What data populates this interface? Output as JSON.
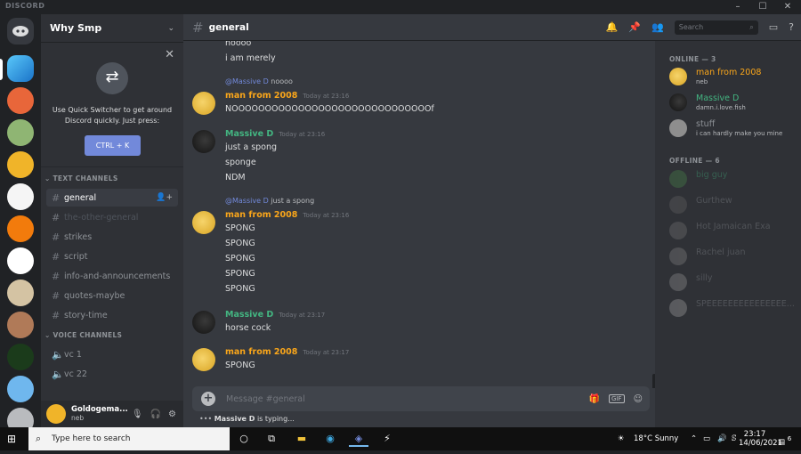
{
  "window": {
    "brand": "DISCORD",
    "controls": [
      "–",
      "☐",
      "✕"
    ]
  },
  "server": {
    "name": "Why Smp"
  },
  "quick_switcher": {
    "message": "Use Quick Switcher to get around Discord quickly. Just press:",
    "shortcut": "CTRL + K"
  },
  "categories": {
    "text": "TEXT CHANNELS",
    "voice": "VOICE CHANNELS"
  },
  "channels": [
    {
      "label": "general",
      "state": "active"
    },
    {
      "label": "the-other-general",
      "state": "muted"
    },
    {
      "label": "strikes",
      "state": "normal"
    },
    {
      "label": "script",
      "state": "normal"
    },
    {
      "label": "info-and-announcements",
      "state": "normal"
    },
    {
      "label": "quotes-maybe",
      "state": "normal"
    },
    {
      "label": "story-time",
      "state": "normal"
    }
  ],
  "voice_channels": [
    {
      "label": "vc 1"
    },
    {
      "label": "vc 22"
    }
  ],
  "user": {
    "name": "Goldogema...",
    "tag": "neb"
  },
  "header": {
    "channel": "general",
    "search_placeholder": "Search"
  },
  "messages": {
    "m1": "noooo",
    "m2": "i am merely",
    "r1_mention": "@Massive D",
    "r1_text": "noooo",
    "u1": "man from 2008",
    "t1": "Today at 23:16",
    "m3": "NOOOOOOOOOOOOOOOOOOOOOOOOOOOOOOf",
    "u2": "Massive D",
    "t2": "Today at 23:16",
    "m4": "just a spong",
    "m5": "sponge",
    "m6": "NDM",
    "r2_mention": "@Massive D",
    "r2_text": "just a spong",
    "u3": "man from 2008",
    "t3": "Today at 23:16",
    "spong": "SPONG",
    "u4": "Massive D",
    "t4": "Today at 23:17",
    "m7": "horse cock",
    "u5": "man from 2008",
    "t5": "Today at 23:17",
    "m8": "SPONG"
  },
  "composer": {
    "placeholder": "Message #general",
    "gif": "GIF"
  },
  "typing": {
    "user": "Massive D",
    "text": " is typing..."
  },
  "members": {
    "online_header": "ONLINE — 3",
    "offline_header": "OFFLINE — 6",
    "online": [
      {
        "name": "man from 2008",
        "status": "neb"
      },
      {
        "name": "Massive D",
        "status": "damn.i.love.fish"
      },
      {
        "name": "stuff",
        "status": "i can hardly make you mine"
      }
    ],
    "offline": [
      {
        "name": "big guy"
      },
      {
        "name": "Gurthew"
      },
      {
        "name": "Hot Jamaican Exa"
      },
      {
        "name": "Rachel juan"
      },
      {
        "name": "silly"
      },
      {
        "name": "SPEEEEEEEEEEEEEEE..."
      }
    ]
  },
  "taskbar": {
    "search": "Type here to search",
    "weather": "18°C  Sunny",
    "time": "23:17",
    "date": "14/06/2021",
    "notif_count": "6"
  }
}
